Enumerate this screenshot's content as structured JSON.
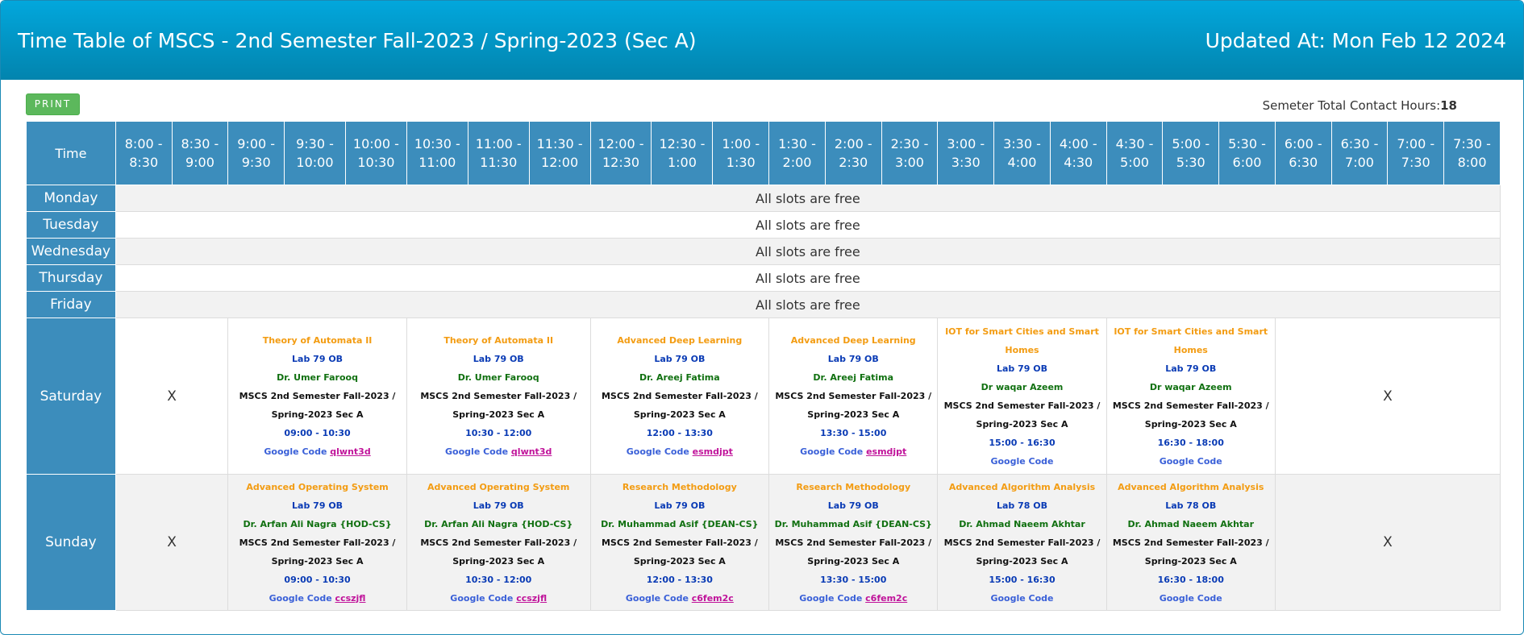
{
  "header": {
    "title": "Time Table of MSCS - 2nd Semester Fall-2023 / Spring-2023 (Sec A)",
    "updated": "Updated At: Mon Feb 12 2024"
  },
  "toolbar": {
    "print_label": "PRINT"
  },
  "contact_hours": {
    "label": "Semeter Total Contact Hours:",
    "value": "18"
  },
  "table": {
    "time_label": "Time",
    "slots": [
      "8:00 - 8:30",
      "8:30 - 9:00",
      "9:00 - 9:30",
      "9:30 - 10:00",
      "10:00 - 10:30",
      "10:30 - 11:00",
      "11:00 - 11:30",
      "11:30 - 12:00",
      "12:00 - 12:30",
      "12:30 - 1:00",
      "1:00 - 1:30",
      "1:30 - 2:00",
      "2:00 - 2:30",
      "2:30 - 3:00",
      "3:00 - 3:30",
      "3:30 - 4:00",
      "4:00 - 4:30",
      "4:30 - 5:00",
      "5:00 - 5:30",
      "5:30 - 6:00",
      "6:00 - 6:30",
      "6:30 - 7:00",
      "7:00 - 7:30",
      "7:30 - 8:00"
    ],
    "free_days": [
      {
        "day": "Monday",
        "text": "All slots are free"
      },
      {
        "day": "Tuesday",
        "text": "All slots are free"
      },
      {
        "day": "Wednesday",
        "text": "All slots are free"
      },
      {
        "day": "Thursday",
        "text": "All slots are free"
      },
      {
        "day": "Friday",
        "text": "All slots are free"
      }
    ],
    "saturday": {
      "day": "Saturday",
      "empty": "X",
      "classes": [
        {
          "title": "Theory of Automata II",
          "room": "Lab 79 OB",
          "teacher": "Dr. Umer Farooq",
          "section": "MSCS 2nd Semester Fall-2023 / Spring-2023 Sec A",
          "time": "09:00 - 10:30",
          "gc_label": "Google Code",
          "code": "qlwnt3d"
        },
        {
          "title": "Theory of Automata II",
          "room": "Lab 79 OB",
          "teacher": "Dr. Umer Farooq",
          "section": "MSCS 2nd Semester Fall-2023 / Spring-2023 Sec A",
          "time": "10:30 - 12:00",
          "gc_label": "Google Code",
          "code": "qlwnt3d"
        },
        {
          "title": "Advanced Deep Learning",
          "room": "Lab 79 OB",
          "teacher": "Dr. Areej Fatima",
          "section": "MSCS 2nd Semester Fall-2023 / Spring-2023 Sec A",
          "time": "12:00 - 13:30",
          "gc_label": "Google Code",
          "code": "esmdjpt"
        },
        {
          "title": "Advanced Deep Learning",
          "room": "Lab 79 OB",
          "teacher": "Dr. Areej Fatima",
          "section": "MSCS 2nd Semester Fall-2023 / Spring-2023 Sec A",
          "time": "13:30 - 15:00",
          "gc_label": "Google Code",
          "code": "esmdjpt"
        },
        {
          "title": "IOT for Smart Cities and Smart Homes",
          "room": "Lab 79 OB",
          "teacher": "Dr waqar Azeem",
          "section": "MSCS 2nd Semester Fall-2023 / Spring-2023 Sec A",
          "time": "15:00 - 16:30",
          "gc_label": "Google Code",
          "code": ""
        },
        {
          "title": "IOT for Smart Cities and Smart Homes",
          "room": "Lab 79 OB",
          "teacher": "Dr waqar Azeem",
          "section": "MSCS 2nd Semester Fall-2023 / Spring-2023 Sec A",
          "time": "16:30 - 18:00",
          "gc_label": "Google Code",
          "code": ""
        }
      ]
    },
    "sunday": {
      "day": "Sunday",
      "empty": "X",
      "classes": [
        {
          "title": "Advanced Operating System",
          "room": "Lab 79 OB",
          "teacher": "Dr. Arfan Ali Nagra {HOD-CS}",
          "section": "MSCS 2nd Semester Fall-2023 / Spring-2023 Sec A",
          "time": "09:00 - 10:30",
          "gc_label": "Google Code",
          "code": "ccszjfl"
        },
        {
          "title": "Advanced Operating System",
          "room": "Lab 79 OB",
          "teacher": "Dr. Arfan Ali Nagra {HOD-CS}",
          "section": "MSCS 2nd Semester Fall-2023 / Spring-2023 Sec A",
          "time": "10:30 - 12:00",
          "gc_label": "Google Code",
          "code": "ccszjfl"
        },
        {
          "title": "Research Methodology",
          "room": "Lab 79 OB",
          "teacher": "Dr. Muhammad Asif {DEAN-CS}",
          "section": "MSCS 2nd Semester Fall-2023 / Spring-2023 Sec A",
          "time": "12:00 - 13:30",
          "gc_label": "Google Code",
          "code": "c6fem2c"
        },
        {
          "title": "Research Methodology",
          "room": "Lab 79 OB",
          "teacher": "Dr. Muhammad Asif {DEAN-CS}",
          "section": "MSCS 2nd Semester Fall-2023 / Spring-2023 Sec A",
          "time": "13:30 - 15:00",
          "gc_label": "Google Code",
          "code": "c6fem2c"
        },
        {
          "title": "Advanced Algorithm Analysis",
          "room": "Lab 78 OB",
          "teacher": "Dr. Ahmad Naeem Akhtar",
          "section": "MSCS 2nd Semester Fall-2023 / Spring-2023 Sec A",
          "time": "15:00 - 16:30",
          "gc_label": "Google Code",
          "code": ""
        },
        {
          "title": "Advanced Algorithm Analysis",
          "room": "Lab 78 OB",
          "teacher": "Dr. Ahmad Naeem Akhtar",
          "section": "MSCS 2nd Semester Fall-2023 / Spring-2023 Sec A",
          "time": "16:30 - 18:00",
          "gc_label": "Google Code",
          "code": ""
        }
      ]
    }
  }
}
